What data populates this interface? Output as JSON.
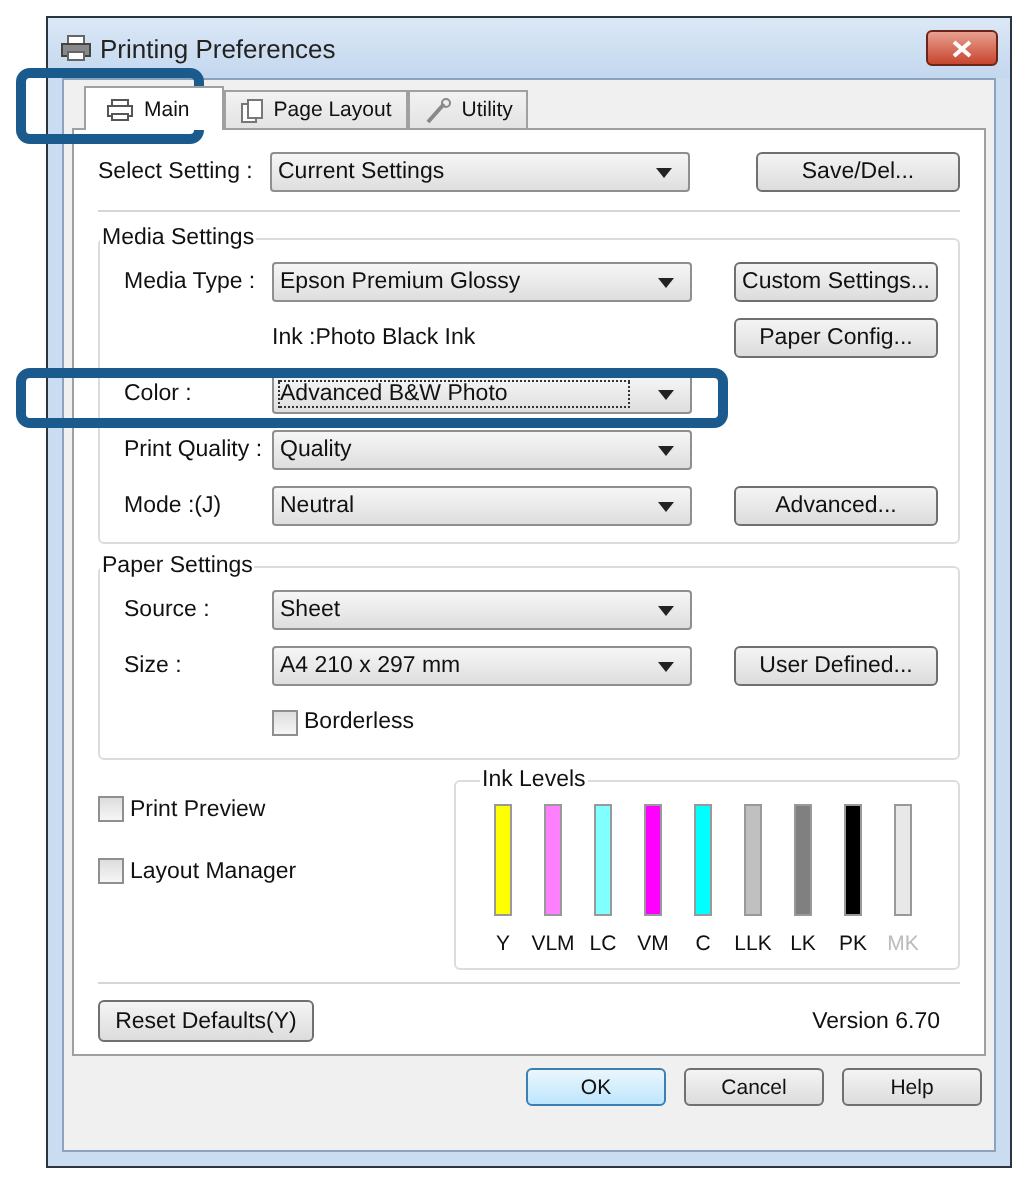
{
  "window": {
    "title": "Printing Preferences"
  },
  "tabs": [
    {
      "label": "Main",
      "selected": true
    },
    {
      "label": "Page Layout",
      "selected": false
    },
    {
      "label": "Utility",
      "selected": false
    }
  ],
  "select_setting": {
    "label": "Select Setting :",
    "value": "Current Settings",
    "button": "Save/Del..."
  },
  "media_settings": {
    "title": "Media Settings",
    "rows": [
      {
        "kind": "combo",
        "label": "Media Type :",
        "value": "Epson Premium Glossy",
        "focused": false,
        "button": "Custom Settings..."
      },
      {
        "kind": "info",
        "text": "Ink :Photo Black Ink",
        "button": "Paper Config..."
      },
      {
        "kind": "combo",
        "label": "Color :",
        "value": "Advanced B&W Photo",
        "focused": true
      },
      {
        "kind": "combo",
        "label": "Print Quality :",
        "value": "Quality",
        "focused": false
      },
      {
        "kind": "combo",
        "label": "Mode :(J)",
        "value": "Neutral",
        "focused": false,
        "button": "Advanced..."
      }
    ]
  },
  "paper_settings": {
    "title": "Paper Settings",
    "rows": [
      {
        "kind": "combo",
        "label": "Source :",
        "value": "Sheet",
        "focused": false
      },
      {
        "kind": "combo",
        "label": "Size :",
        "value": "A4 210 x 297 mm",
        "focused": false,
        "button": "User Defined..."
      },
      {
        "kind": "checkbox",
        "label": "Borderless",
        "checked": false
      }
    ]
  },
  "options": [
    {
      "label": "Print Preview",
      "checked": false
    },
    {
      "label": "Layout Manager",
      "checked": false
    }
  ],
  "ink_levels": {
    "title": "Ink Levels",
    "inks": [
      {
        "name": "Y",
        "color": "#ffff00",
        "level": 1,
        "disabled": false
      },
      {
        "name": "VLM",
        "color": "#ff80ff",
        "level": 1,
        "disabled": false
      },
      {
        "name": "LC",
        "color": "#80ffff",
        "level": 1,
        "disabled": false
      },
      {
        "name": "VM",
        "color": "#ff00ff",
        "level": 1,
        "disabled": false
      },
      {
        "name": "C",
        "color": "#00ffff",
        "level": 1,
        "disabled": false
      },
      {
        "name": "LLK",
        "color": "#c0c0c0",
        "level": 1,
        "disabled": false
      },
      {
        "name": "LK",
        "color": "#808080",
        "level": 1,
        "disabled": false
      },
      {
        "name": "PK",
        "color": "#000000",
        "level": 1,
        "disabled": false
      },
      {
        "name": "MK",
        "color": "#e8e8e8",
        "level": 1,
        "disabled": true
      }
    ]
  },
  "reset_button": "Reset Defaults(Y)",
  "version": "Version 6.70",
  "buttons": [
    {
      "label": "OK",
      "default": true
    },
    {
      "label": "Cancel",
      "default": false
    },
    {
      "label": "Help",
      "default": false
    }
  ]
}
